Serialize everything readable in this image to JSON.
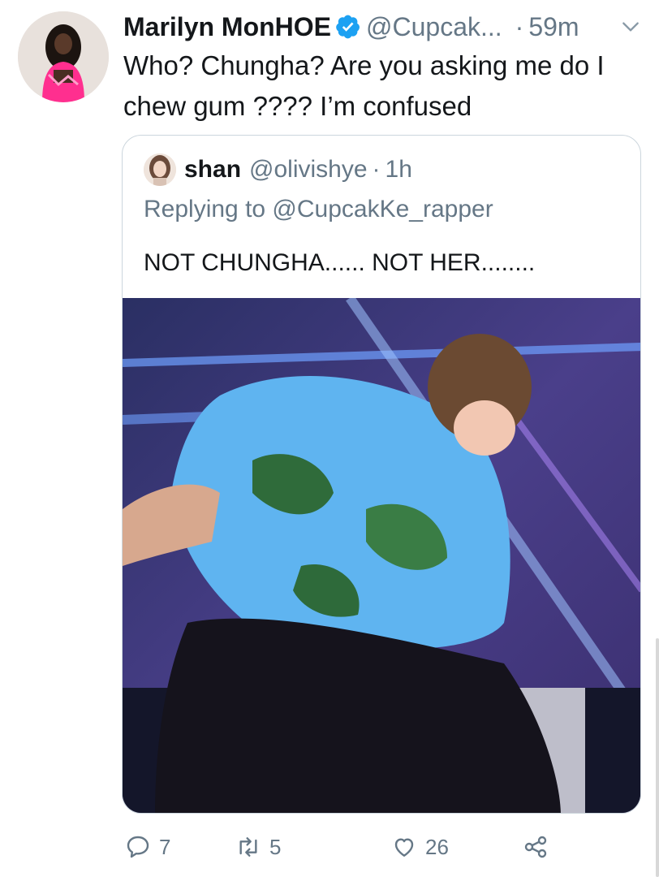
{
  "tweet": {
    "display_name": "Marilyn MonHOE",
    "handle": "@Cupcak...",
    "separator": "·",
    "time": "59m",
    "text": "Who? Chungha? Are you asking me do I chew gum ???? I’m confused"
  },
  "quote": {
    "display_name": "shan",
    "handle": "@olivishye",
    "separator": "·",
    "time": "1h",
    "replying_to": "Replying to @CupcakKe_rapper",
    "text": "NOT CHUNGHA...... NOT HER........"
  },
  "actions": {
    "reply_count": "7",
    "retweet_count": "5",
    "like_count": "26"
  },
  "icons": {
    "verified": "verified-badge-icon",
    "more": "chevron-down-icon",
    "reply": "reply-icon",
    "retweet": "retweet-icon",
    "like": "heart-icon",
    "share": "share-icon"
  },
  "colors": {
    "text": "#14171a",
    "secondary": "#657786",
    "verified": "#1da1f2",
    "border": "#ccd6dd"
  }
}
